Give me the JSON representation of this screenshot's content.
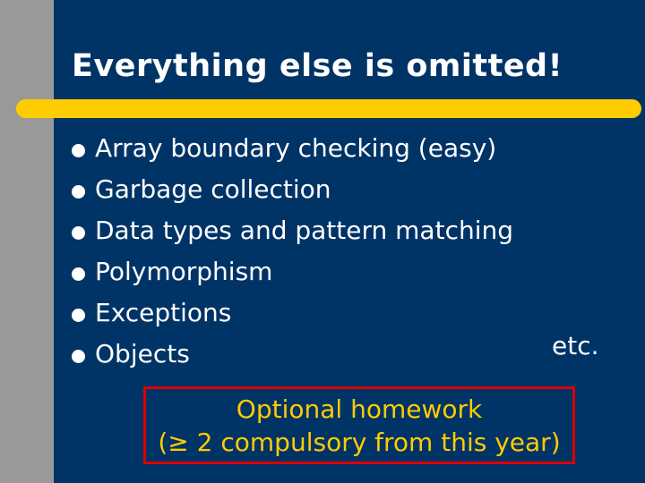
{
  "slide": {
    "title": "Everything else is omitted!",
    "bullets": [
      "Array boundary checking (easy)",
      "Garbage collection",
      "Data types and pattern matching",
      "Polymorphism",
      "Exceptions",
      "Objects"
    ],
    "aside": "etc.",
    "homework": {
      "line1": "Optional homework",
      "line2": "(≥ 2 compulsory from this year)"
    }
  },
  "colors": {
    "background": "#003366",
    "left_bar": "#999999",
    "accent_rule": "#ffcc00",
    "text": "#ffffff",
    "homework_text": "#ffcc00",
    "homework_border": "#dd0000"
  }
}
